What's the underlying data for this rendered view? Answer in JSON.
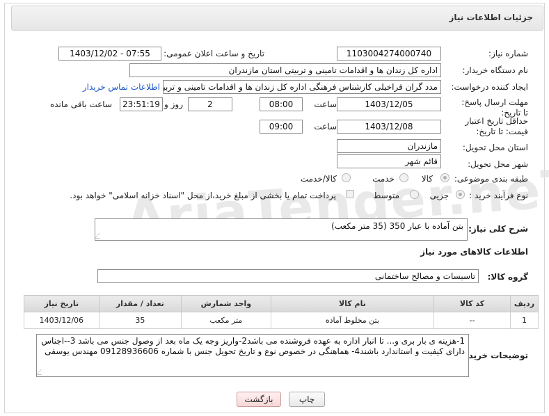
{
  "header": {
    "title": "جزئیات اطلاعات نیاز"
  },
  "watermark": "AriaTender.neT",
  "fields": {
    "need_number_label": "شماره نیاز:",
    "need_number": "1103004274000740",
    "announce_label": "تاریخ و ساعت اعلان عمومی:",
    "announce_value": "1403/12/02 - 07:55",
    "buyer_org_label": "نام دستگاه خریدار:",
    "buyer_org": "اداره کل زندان ها و اقدامات تامینی و تربیتی استان مازندران",
    "requester_label": "ایجاد کننده درخواست:",
    "requester": "مدد گران قراخیلی کارشناس فرهنگی اداره کل زندان ها و اقدامات تامینی و تربیتی",
    "buyer_contact_link": "اطلاعات تماس خریدار",
    "deadline_label": "مهلت ارسال پاسخ: تا تاریخ:",
    "deadline_date": "1403/12/05",
    "time_label": "ساعت",
    "deadline_time": "08:00",
    "days_value": "2",
    "days_label": "روز و",
    "remaining_time": "23:51:19",
    "remaining_label": "ساعت باقی مانده",
    "validity_label": "حداقل تاریخ اعتبار قیمت: تا تاریخ:",
    "validity_date": "1403/12/08",
    "validity_time": "09:00",
    "province_label": "استان محل تحویل:",
    "province": "مازندران",
    "city_label": "شهر محل تحویل:",
    "city": "قائم شهر",
    "category_label": "طبقه بندی موضوعی:",
    "category_options": [
      "کالا",
      "خدمت",
      "کالا/خدمت"
    ],
    "process_label": "نوع فرآیند خرید :",
    "process_options": [
      "جزیی",
      "متوسط"
    ],
    "payment_note": "پرداخت تمام یا بخشی از مبلغ خرید،از محل \"اسناد خزانه اسلامی\" خواهد بود.",
    "description_label": "شرح کلی نیاز:",
    "description": "بتن آماده با عیار 350 (35 متر مکعب)",
    "goods_info_title": "اطلاعات کالاهای مورد نیاز",
    "goods_group_label": "گروه کالا:",
    "goods_group": "تاسیسات و مصالح ساختمانی",
    "buyer_notes_label": "توضیحات خریدار:",
    "buyer_notes": "1-هزینه ی بار بری و... تا انبار اداره به عهده فروشنده می باشد2-واریز وجه یک ماه بعد از وصول جنس می باشد 3--اجناس دارای کیفیت و استاندارد باشند4- هماهنگی در خصوص نوع و تاریخ تحویل جنس با شماره 09128936606 مهندس یوسفی"
  },
  "table": {
    "headers": [
      "ردیف",
      "کد کالا",
      "نام کالا",
      "واحد شمارش",
      "تعداد / مقدار",
      "تاریخ نیاز"
    ],
    "rows": [
      [
        "1",
        "--",
        "بتن مخلوط آماده",
        "متر مکعب",
        "35",
        "1403/12/06"
      ]
    ]
  },
  "buttons": {
    "print": "چاپ",
    "back": "بازگشت"
  }
}
